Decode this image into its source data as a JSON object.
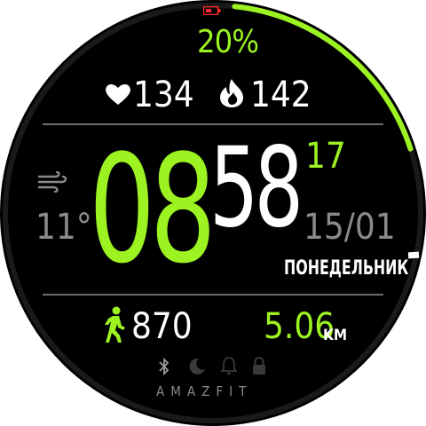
{
  "battery": {
    "percent_text": "20%",
    "level": 0.2
  },
  "stats": {
    "heart_rate": "134",
    "calories": "142"
  },
  "time": {
    "hours": "08",
    "minutes": "58",
    "seconds": "17"
  },
  "date": {
    "date": "15/01",
    "weekday": "ПОНЕДЕЛЬНИК"
  },
  "weather": {
    "temperature": "11°",
    "icon": "wind-icon"
  },
  "activity": {
    "steps": "870",
    "distance_value": "5.06",
    "distance_unit": "KM"
  },
  "status_icons": [
    "bluetooth-icon",
    "moon-icon",
    "bell-icon",
    "lock-icon"
  ],
  "brand": "AMAZFIT",
  "colors": {
    "accent": "#9cf321",
    "background": "#000000",
    "battery_low": "#ff2a2a",
    "divider": "#6f6f6f",
    "muted": "#8a8a8a"
  }
}
